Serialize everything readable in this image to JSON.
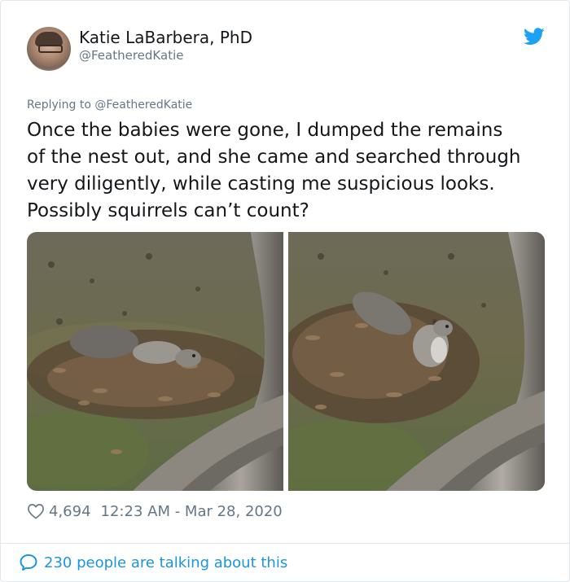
{
  "author": {
    "display_name": "Katie LaBarbera, PhD",
    "handle": "@FeatheredKatie"
  },
  "icons": {
    "platform": "twitter-bird-icon",
    "like": "heart-icon",
    "conversation": "speech-bubble-icon"
  },
  "colors": {
    "brand_blue": "#1da1f2",
    "link_blue": "#1b95e0",
    "secondary_text": "#657786"
  },
  "reply": {
    "prefix": "Replying to",
    "target": "@FeatheredKatie"
  },
  "tweet": {
    "lines": [
      "Once the babies were gone, I dumped the remains",
      "of the nest out, and she came and searched through",
      "very diligently, while casting me suspicious looks.",
      "Possibly squirrels can’t count?"
    ]
  },
  "meta": {
    "likes": "4,694",
    "timestamp": "12:23 AM - Mar 28, 2020"
  },
  "footer": {
    "talking_text": "230 people are talking about this"
  }
}
